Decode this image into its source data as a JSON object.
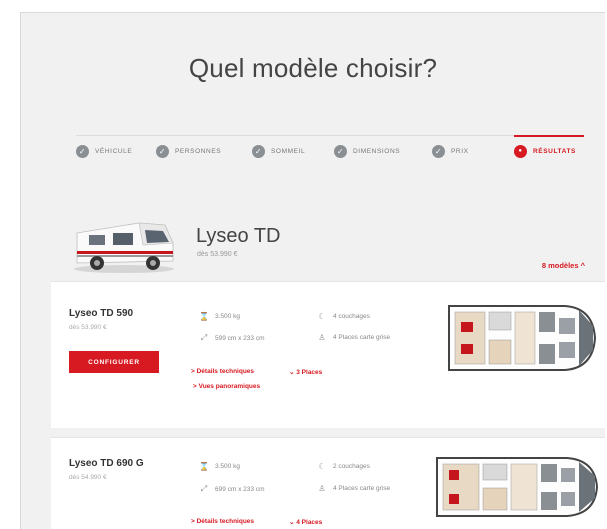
{
  "page": {
    "title": "Quel modèle choisir?"
  },
  "steps": [
    {
      "label": "Véhicule",
      "icon": "check-icon"
    },
    {
      "label": "Personnes",
      "icon": "check-icon"
    },
    {
      "label": "Sommeil",
      "icon": "check-icon"
    },
    {
      "label": "Dimensions",
      "icon": "check-icon"
    },
    {
      "label": "Prix",
      "icon": "check-icon"
    },
    {
      "label": "Résultats",
      "icon": "dot-icon",
      "active": true
    }
  ],
  "model": {
    "name": "Lyseo TD",
    "price": "dès 53.990 €",
    "models_link": "8 modèles ^"
  },
  "variants": [
    {
      "name": "Lyseo TD 590",
      "price": "dès 53.990 €",
      "configure_label": "Configurer",
      "specs": {
        "weight": "3.500 kg",
        "beds": "4 couchages",
        "size": "599 cm x 233 cm",
        "seats": "4 Places carte grise"
      },
      "details_link": "> Détails techniques",
      "places_link": "⌄ 3 Places",
      "panoramic_link": "> Vues panoramiques"
    },
    {
      "name": "Lyseo TD 690 G",
      "price": "dès 54.990 €",
      "specs": {
        "weight": "3.500 kg",
        "beds": "2 couchages",
        "size": "699 cm x 233 cm",
        "seats": "4 Places carte grise"
      },
      "details_link": "> Détails techniques",
      "places_link": "⌄ 4 Places"
    }
  ],
  "colors": {
    "accent": "#d71921",
    "step_icon": "#8a8f94",
    "background": "#f1f1f1"
  }
}
